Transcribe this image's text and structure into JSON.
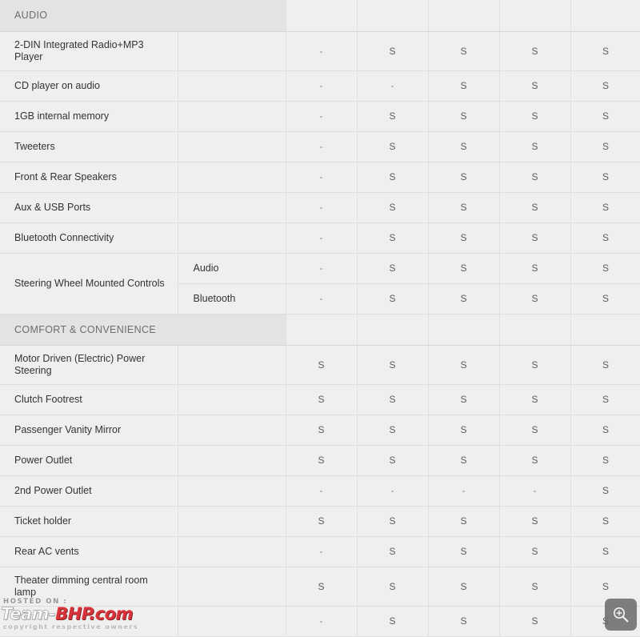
{
  "table": {
    "columns": [
      {
        "key": "feature",
        "label": ""
      },
      {
        "key": "subfeature",
        "label": ""
      },
      {
        "key": "variant1",
        "label": ""
      },
      {
        "key": "variant2",
        "label": ""
      },
      {
        "key": "variant3",
        "label": ""
      },
      {
        "key": "variant4",
        "label": ""
      },
      {
        "key": "variant5",
        "label": ""
      }
    ],
    "sections": [
      {
        "title": "AUDIO",
        "rows": [
          {
            "feature": "2-DIN Integrated Radio+MP3 Player",
            "sub": "",
            "values": [
              "-",
              "S",
              "S",
              "S",
              "S"
            ]
          },
          {
            "feature": "CD player on audio",
            "sub": "",
            "values": [
              "-",
              "-",
              "S",
              "S",
              "S"
            ]
          },
          {
            "feature": "1GB internal memory",
            "sub": "",
            "values": [
              "-",
              "S",
              "S",
              "S",
              "S"
            ]
          },
          {
            "feature": "Tweeters",
            "sub": "",
            "values": [
              "-",
              "S",
              "S",
              "S",
              "S"
            ]
          },
          {
            "feature": "Front & Rear Speakers",
            "sub": "",
            "values": [
              "-",
              "S",
              "S",
              "S",
              "S"
            ]
          },
          {
            "feature": "Aux & USB Ports",
            "sub": "",
            "values": [
              "-",
              "S",
              "S",
              "S",
              "S"
            ]
          },
          {
            "feature": "Bluetooth Connectivity",
            "sub": "",
            "values": [
              "-",
              "S",
              "S",
              "S",
              "S"
            ]
          },
          {
            "feature": "Steering Wheel Mounted Controls",
            "subrows": [
              {
                "sub": "Audio",
                "values": [
                  "-",
                  "S",
                  "S",
                  "S",
                  "S"
                ]
              },
              {
                "sub": "Bluetooth",
                "values": [
                  "-",
                  "S",
                  "S",
                  "S",
                  "S"
                ]
              }
            ]
          }
        ]
      },
      {
        "title": "COMFORT & CONVENIENCE",
        "rows": [
          {
            "feature": "Motor Driven (Electric) Power Steering",
            "sub": "",
            "values": [
              "S",
              "S",
              "S",
              "S",
              "S"
            ]
          },
          {
            "feature": "Clutch Footrest",
            "sub": "",
            "values": [
              "S",
              "S",
              "S",
              "S",
              "S"
            ]
          },
          {
            "feature": "Passenger Vanity Mirror",
            "sub": "",
            "values": [
              "S",
              "S",
              "S",
              "S",
              "S"
            ]
          },
          {
            "feature": "Power Outlet",
            "sub": "",
            "values": [
              "S",
              "S",
              "S",
              "S",
              "S"
            ]
          },
          {
            "feature": "2nd Power Outlet",
            "sub": "",
            "values": [
              "-",
              "-",
              "-",
              "-",
              "S"
            ]
          },
          {
            "feature": "Ticket holder",
            "sub": "",
            "values": [
              "S",
              "S",
              "S",
              "S",
              "S"
            ]
          },
          {
            "feature": "Rear AC vents",
            "sub": "",
            "values": [
              "-",
              "S",
              "S",
              "S",
              "S"
            ]
          },
          {
            "feature": "Theater dimming central room lamp",
            "sub": "",
            "values": [
              "S",
              "S",
              "S",
              "S",
              "S"
            ]
          },
          {
            "feature": "",
            "sub": "",
            "values": [
              "-",
              "S",
              "S",
              "S",
              "S"
            ]
          }
        ]
      }
    ]
  },
  "watermark": {
    "hosted_label": "HOSTED ON :",
    "logo_team": "Team-",
    "logo_bhp": "BHP.com",
    "copyright": "copyright respective owners"
  },
  "zoom_badge": {
    "icon": "zoom-in-icon",
    "label": ""
  },
  "colors": {
    "cell_background": "#efefee",
    "section_background": "#e3e3e1",
    "grid_line": "#e0e0de",
    "feature_text": "#333333",
    "section_text": "#6d6d6d",
    "value_text": "#5c5c5c",
    "logo_red": "#d8232a"
  }
}
